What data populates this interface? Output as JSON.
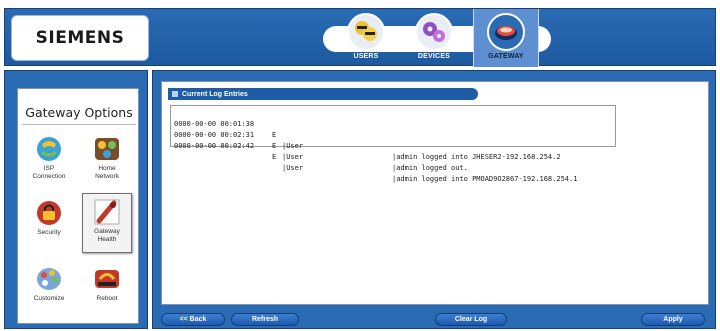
{
  "brand": {
    "logo": "SIEMENS"
  },
  "nav": {
    "tabs": [
      {
        "label": "USERS",
        "icon": "users-icon"
      },
      {
        "label": "DEVICES",
        "icon": "devices-icon"
      },
      {
        "label": "GATEWAY",
        "icon": "gateway-icon",
        "active": true
      }
    ]
  },
  "sidebar": {
    "title": "Gateway Options",
    "items": [
      {
        "label": "ISP\nConnection",
        "icon": "isp-connection-icon"
      },
      {
        "label": "Home\nNetwork",
        "icon": "home-network-icon"
      },
      {
        "label": "Security",
        "icon": "security-icon"
      },
      {
        "label": "Gateway\nHealth",
        "icon": "gateway-health-icon",
        "selected": true
      },
      {
        "label": "Customize",
        "icon": "customize-icon"
      },
      {
        "label": "Reboot",
        "icon": "reboot-icon"
      }
    ]
  },
  "log": {
    "title": "Current Log Entries",
    "entries": [
      {
        "time": "0000-00-00 00:01:38",
        "level": "E",
        "source": "|User",
        "message": "|admin logged into JHESER2-192.168.254.2"
      },
      {
        "time": "0000-00-00 00:02:31",
        "level": "E",
        "source": "|User",
        "message": "|admin logged out."
      },
      {
        "time": "0000-00-00 00:02:42",
        "level": "E",
        "source": "|User",
        "message": "|admin logged into PMOAD9O2867-192.168.254.1"
      }
    ]
  },
  "buttons": {
    "back": "<< Back",
    "refresh": "Refresh",
    "clear_log": "Clear Log",
    "apply": "Apply"
  },
  "colors": {
    "frame_blue": "#2a6bb3",
    "button_blue": "#1b5ab0"
  }
}
